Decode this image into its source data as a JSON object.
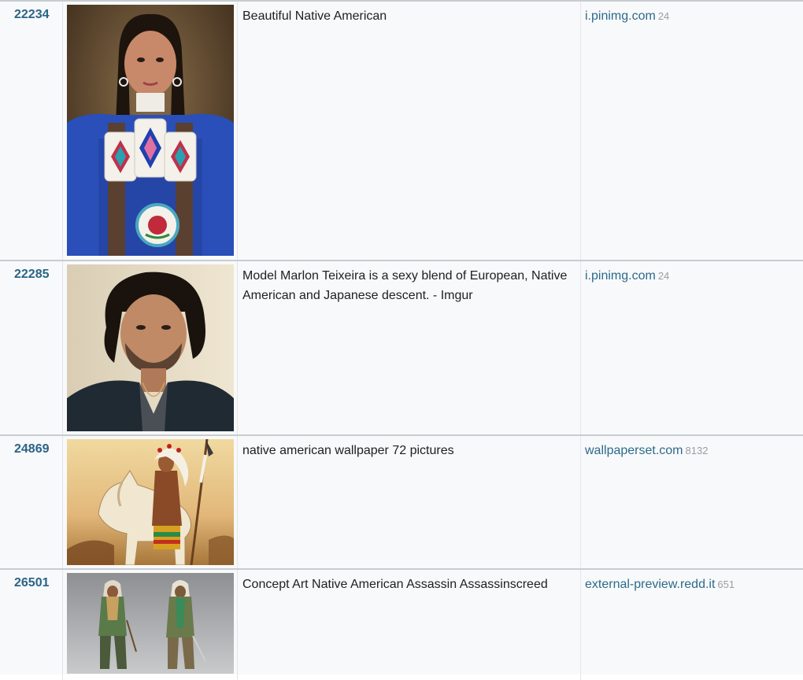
{
  "rows": [
    {
      "id": "22234",
      "title": "Beautiful Native American",
      "source": "i.pinimg.com",
      "count": "24",
      "thumb": "portrait-woman-beaded-regalia"
    },
    {
      "id": "22285",
      "title": "Model Marlon Teixeira is a sexy blend of European, Native American and Japanese descent. - Imgur",
      "source": "i.pinimg.com",
      "count": "24",
      "thumb": "portrait-man-curly-hair"
    },
    {
      "id": "24869",
      "title": "native american wallpaper 72 pictures",
      "source": "wallpaperset.com",
      "count": "8132",
      "thumb": "chief-on-horse-painting"
    },
    {
      "id": "26501",
      "title": "Concept Art Native American Assassin Assassinscreed",
      "source": "external-preview.redd.it",
      "count": "651",
      "thumb": "assassin-concept-art"
    }
  ]
}
